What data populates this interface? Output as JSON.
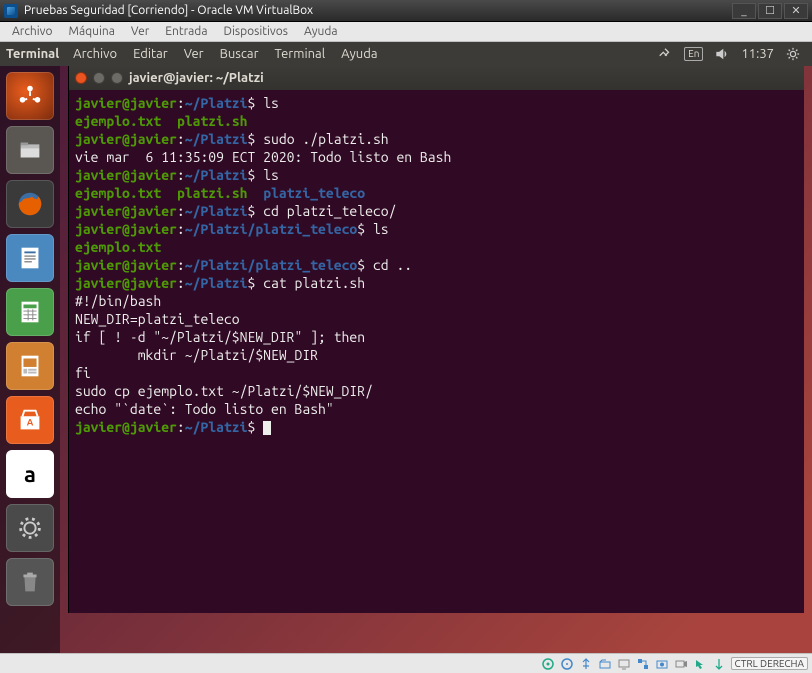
{
  "vbox": {
    "title": "Pruebas Seguridad [Corriendo] - Oracle VM VirtualBox",
    "menu": [
      "Archivo",
      "Máquina",
      "Ver",
      "Entrada",
      "Dispositivos",
      "Ayuda"
    ],
    "winctrls": {
      "min": "_",
      "max": "☐",
      "close": "✕"
    },
    "host_key": "CTRL DERECHA"
  },
  "ubuntu_panel": {
    "app_title": "Terminal",
    "app_menu": [
      "Archivo",
      "Editar",
      "Ver",
      "Buscar",
      "Terminal",
      "Ayuda"
    ],
    "keyboard_indicator": "En",
    "clock": "11:37"
  },
  "terminal": {
    "window_title": "javier@javier: ~/Platzi",
    "prompt_user": "javier@javier",
    "prompt_sep1": ":",
    "prompt_sep2": "$",
    "lines": [
      {
        "type": "prompt",
        "path": "~/Platzi",
        "cmd": "ls"
      },
      {
        "type": "ls",
        "items": [
          {
            "name": "ejemplo.txt",
            "class": "c-green"
          },
          {
            "name": "platzi.sh",
            "class": "c-green"
          }
        ]
      },
      {
        "type": "prompt",
        "path": "~/Platzi",
        "cmd": "sudo ./platzi.sh"
      },
      {
        "type": "out",
        "text": "vie mar  6 11:35:09 ECT 2020: Todo listo en Bash"
      },
      {
        "type": "prompt",
        "path": "~/Platzi",
        "cmd": "ls"
      },
      {
        "type": "ls",
        "items": [
          {
            "name": "ejemplo.txt",
            "class": "c-green"
          },
          {
            "name": "platzi.sh",
            "class": "c-green"
          },
          {
            "name": "platzi_teleco",
            "class": "c-blue"
          }
        ]
      },
      {
        "type": "prompt",
        "path": "~/Platzi",
        "cmd": "cd platzi_teleco/"
      },
      {
        "type": "prompt",
        "path": "~/Platzi/platzi_teleco",
        "cmd": "ls"
      },
      {
        "type": "ls",
        "items": [
          {
            "name": "ejemplo.txt",
            "class": "c-green"
          }
        ]
      },
      {
        "type": "prompt",
        "path": "~/Platzi/platzi_teleco",
        "cmd": "cd .."
      },
      {
        "type": "prompt",
        "path": "~/Platzi",
        "cmd": "cat platzi.sh"
      },
      {
        "type": "out",
        "text": "#!/bin/bash"
      },
      {
        "type": "out",
        "text": ""
      },
      {
        "type": "out",
        "text": "NEW_DIR=platzi_teleco"
      },
      {
        "type": "out",
        "text": ""
      },
      {
        "type": "out",
        "text": "if [ ! -d \"~/Platzi/$NEW_DIR\" ]; then"
      },
      {
        "type": "out",
        "text": "        mkdir ~/Platzi/$NEW_DIR"
      },
      {
        "type": "out",
        "text": "fi"
      },
      {
        "type": "out",
        "text": ""
      },
      {
        "type": "out",
        "text": "sudo cp ejemplo.txt ~/Platzi/$NEW_DIR/"
      },
      {
        "type": "out",
        "text": "echo \"`date`: Todo listo en Bash\""
      },
      {
        "type": "out",
        "text": ""
      },
      {
        "type": "prompt",
        "path": "~/Platzi",
        "cmd": "",
        "cursor": true
      }
    ]
  },
  "launcher_items": [
    {
      "id": "dash",
      "label": "Dash"
    },
    {
      "id": "files",
      "label": "Files"
    },
    {
      "id": "firefox",
      "label": "Firefox"
    },
    {
      "id": "writer",
      "label": "LibreOffice Writer"
    },
    {
      "id": "calc",
      "label": "LibreOffice Calc"
    },
    {
      "id": "impress",
      "label": "LibreOffice Impress"
    },
    {
      "id": "software",
      "label": "Ubuntu Software"
    },
    {
      "id": "amazon",
      "label": "Amazon",
      "glyph": "a"
    },
    {
      "id": "settings",
      "label": "System Settings"
    },
    {
      "id": "trash",
      "label": "Trash"
    }
  ],
  "status_icons": [
    "hdd",
    "cd",
    "usb",
    "audio",
    "net",
    "shared",
    "display",
    "rec",
    "capture",
    "mouse"
  ]
}
